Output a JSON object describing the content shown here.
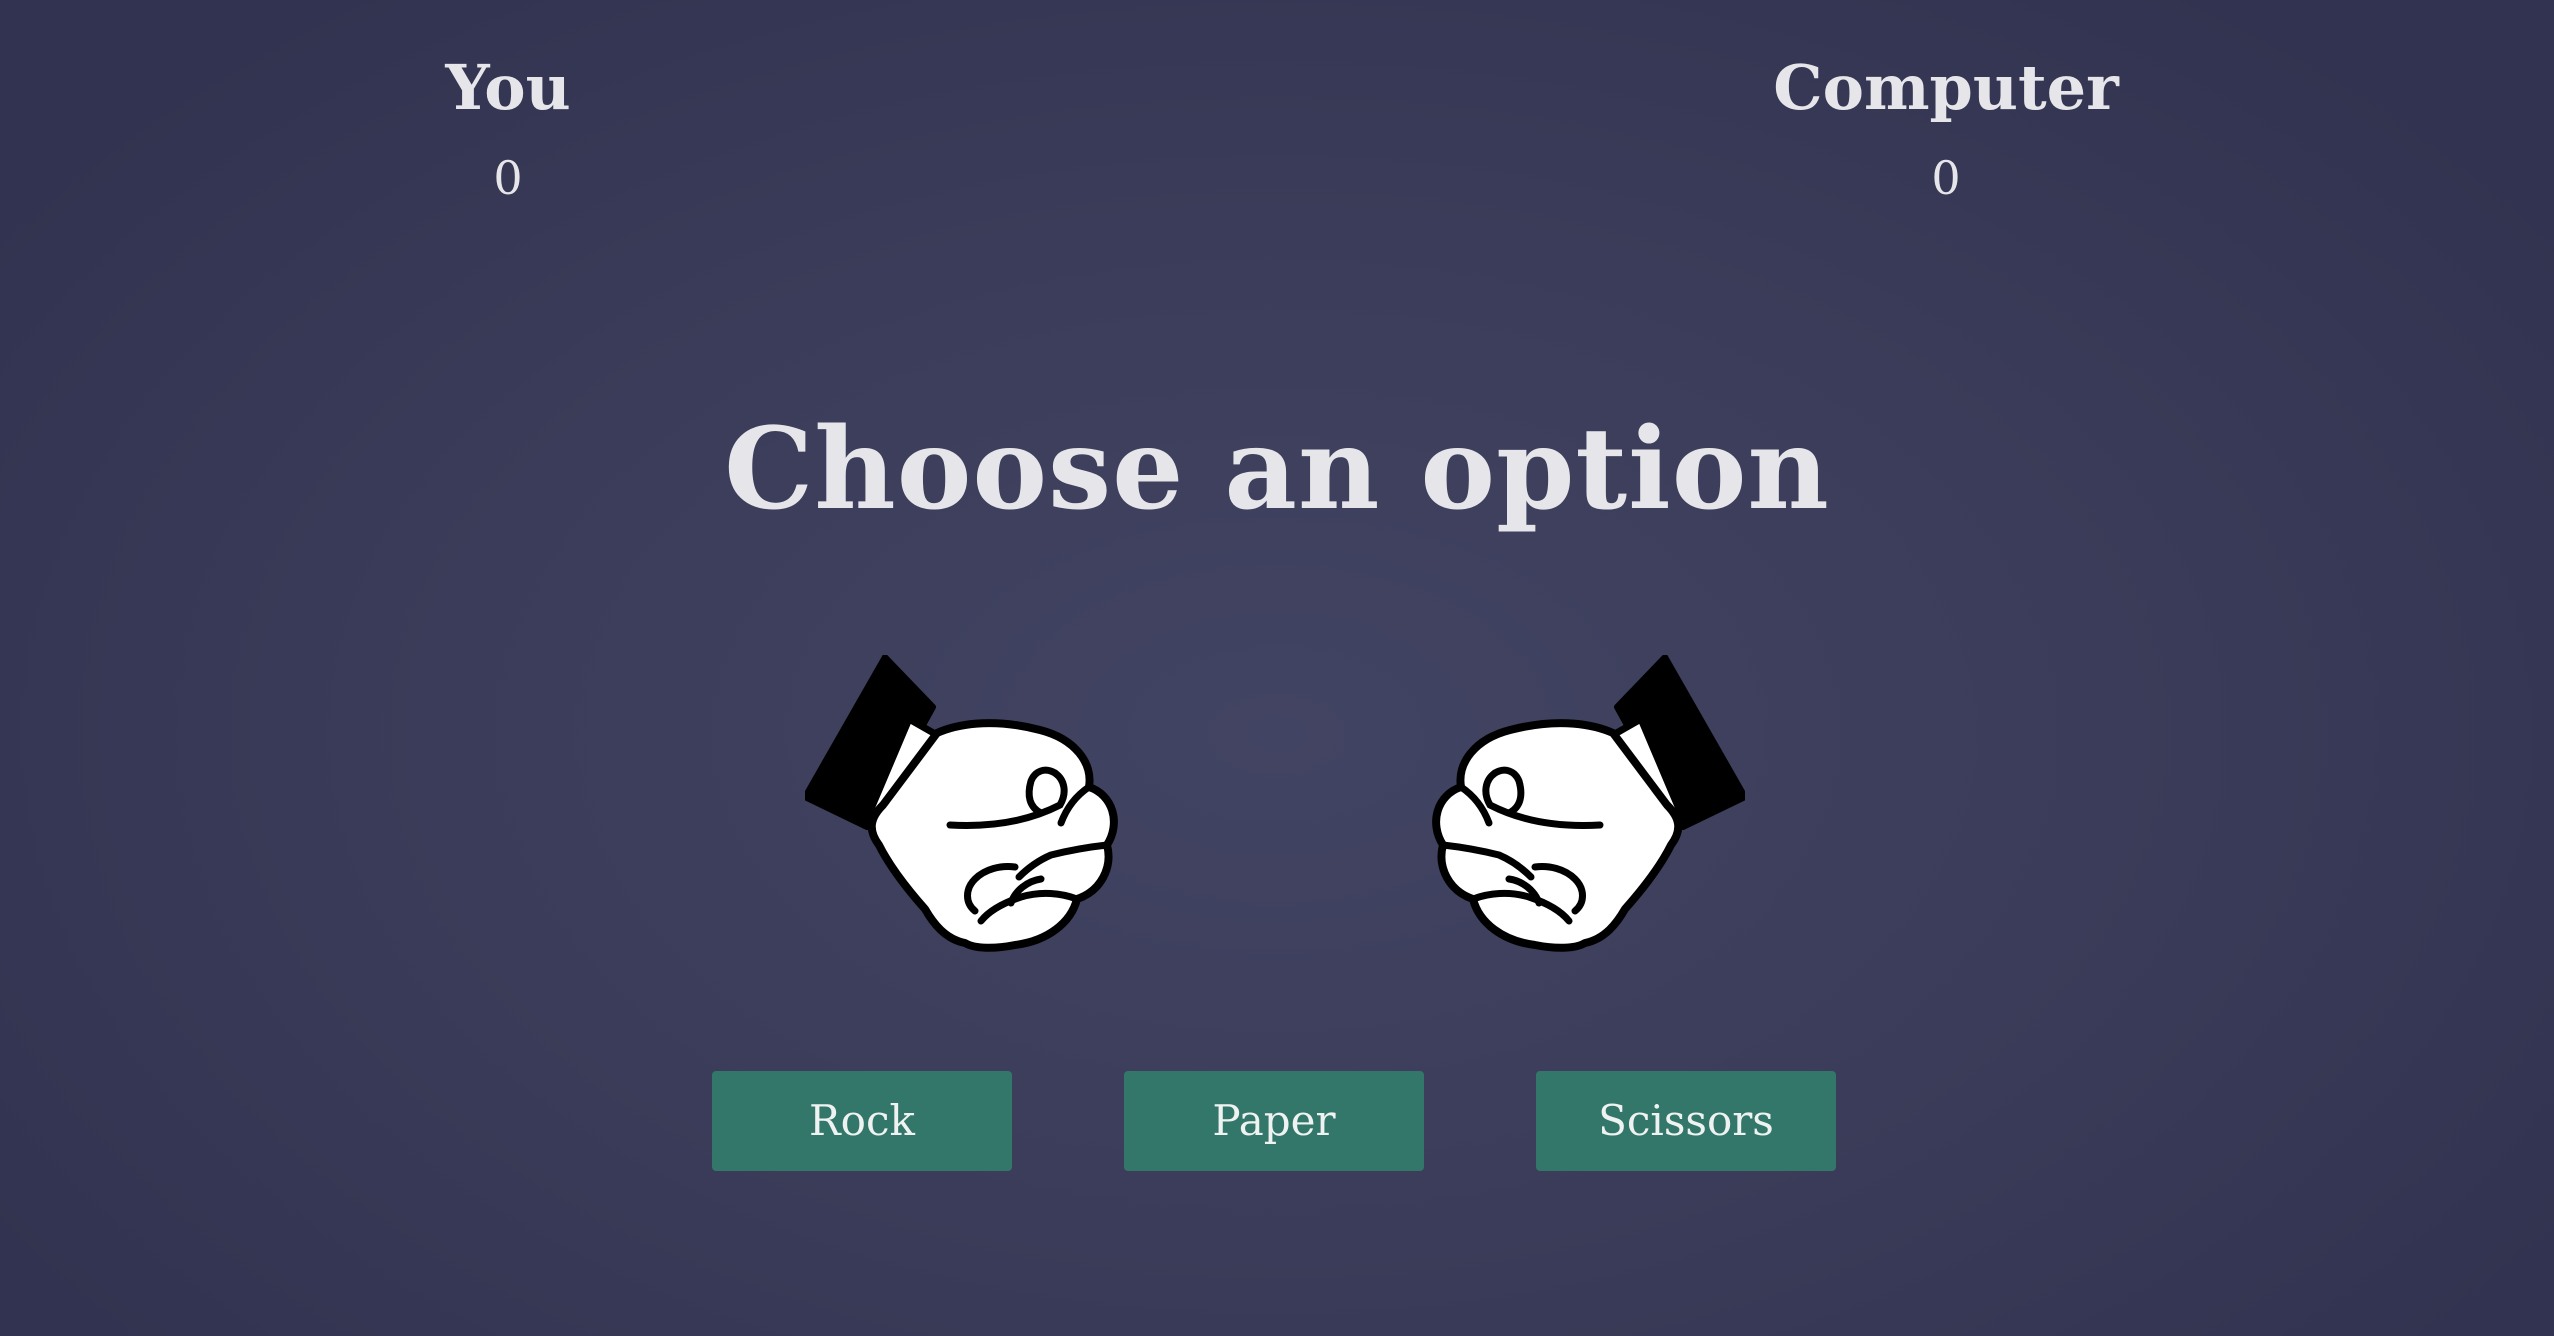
{
  "scoreboard": {
    "player_label": "You",
    "player_score": "0",
    "computer_label": "Computer",
    "computer_score": "0"
  },
  "prompt": "Choose an option",
  "hands": {
    "player_icon": "fist-icon",
    "computer_icon": "fist-icon"
  },
  "options": {
    "rock_label": "Rock",
    "paper_label": "Paper",
    "scissors_label": "Scissors"
  },
  "colors": {
    "background": "#3a3c59",
    "button": "#33766a",
    "text": "#e6e6ea"
  }
}
